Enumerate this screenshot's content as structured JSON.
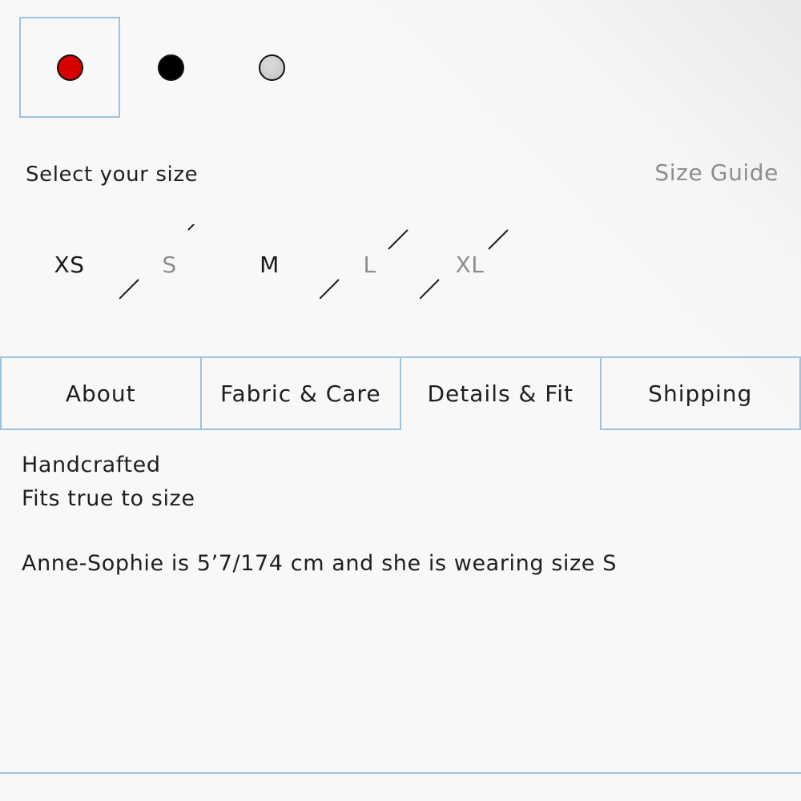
{
  "colors": {
    "selected_border": "#9cc3df",
    "unavailable_text": "#8e8e90",
    "size_guide_text": "#8d8d8f"
  },
  "swatches": [
    {
      "name": "red",
      "color": "#d60000",
      "selected": true
    },
    {
      "name": "black",
      "color": "#000000",
      "selected": false
    },
    {
      "name": "grey",
      "color": "#cfcfcf",
      "selected": false
    }
  ],
  "size_selector": {
    "label": "Select your size",
    "guide_link": "Size Guide",
    "sizes": [
      {
        "label": "XS",
        "available": true
      },
      {
        "label": "S",
        "available": false
      },
      {
        "label": "M",
        "available": true
      },
      {
        "label": "L",
        "available": false
      },
      {
        "label": "XL",
        "available": false
      }
    ]
  },
  "tabs": [
    {
      "label": "About",
      "active": false
    },
    {
      "label": "Fabric & Care",
      "active": false
    },
    {
      "label": "Details & Fit",
      "active": true
    },
    {
      "label": "Shipping",
      "active": false
    }
  ],
  "details": {
    "line1": "Handcrafted",
    "line2": "Fits true to size",
    "model_note": "Anne-Sophie is 5’7/174 cm and she is wearing size S"
  }
}
